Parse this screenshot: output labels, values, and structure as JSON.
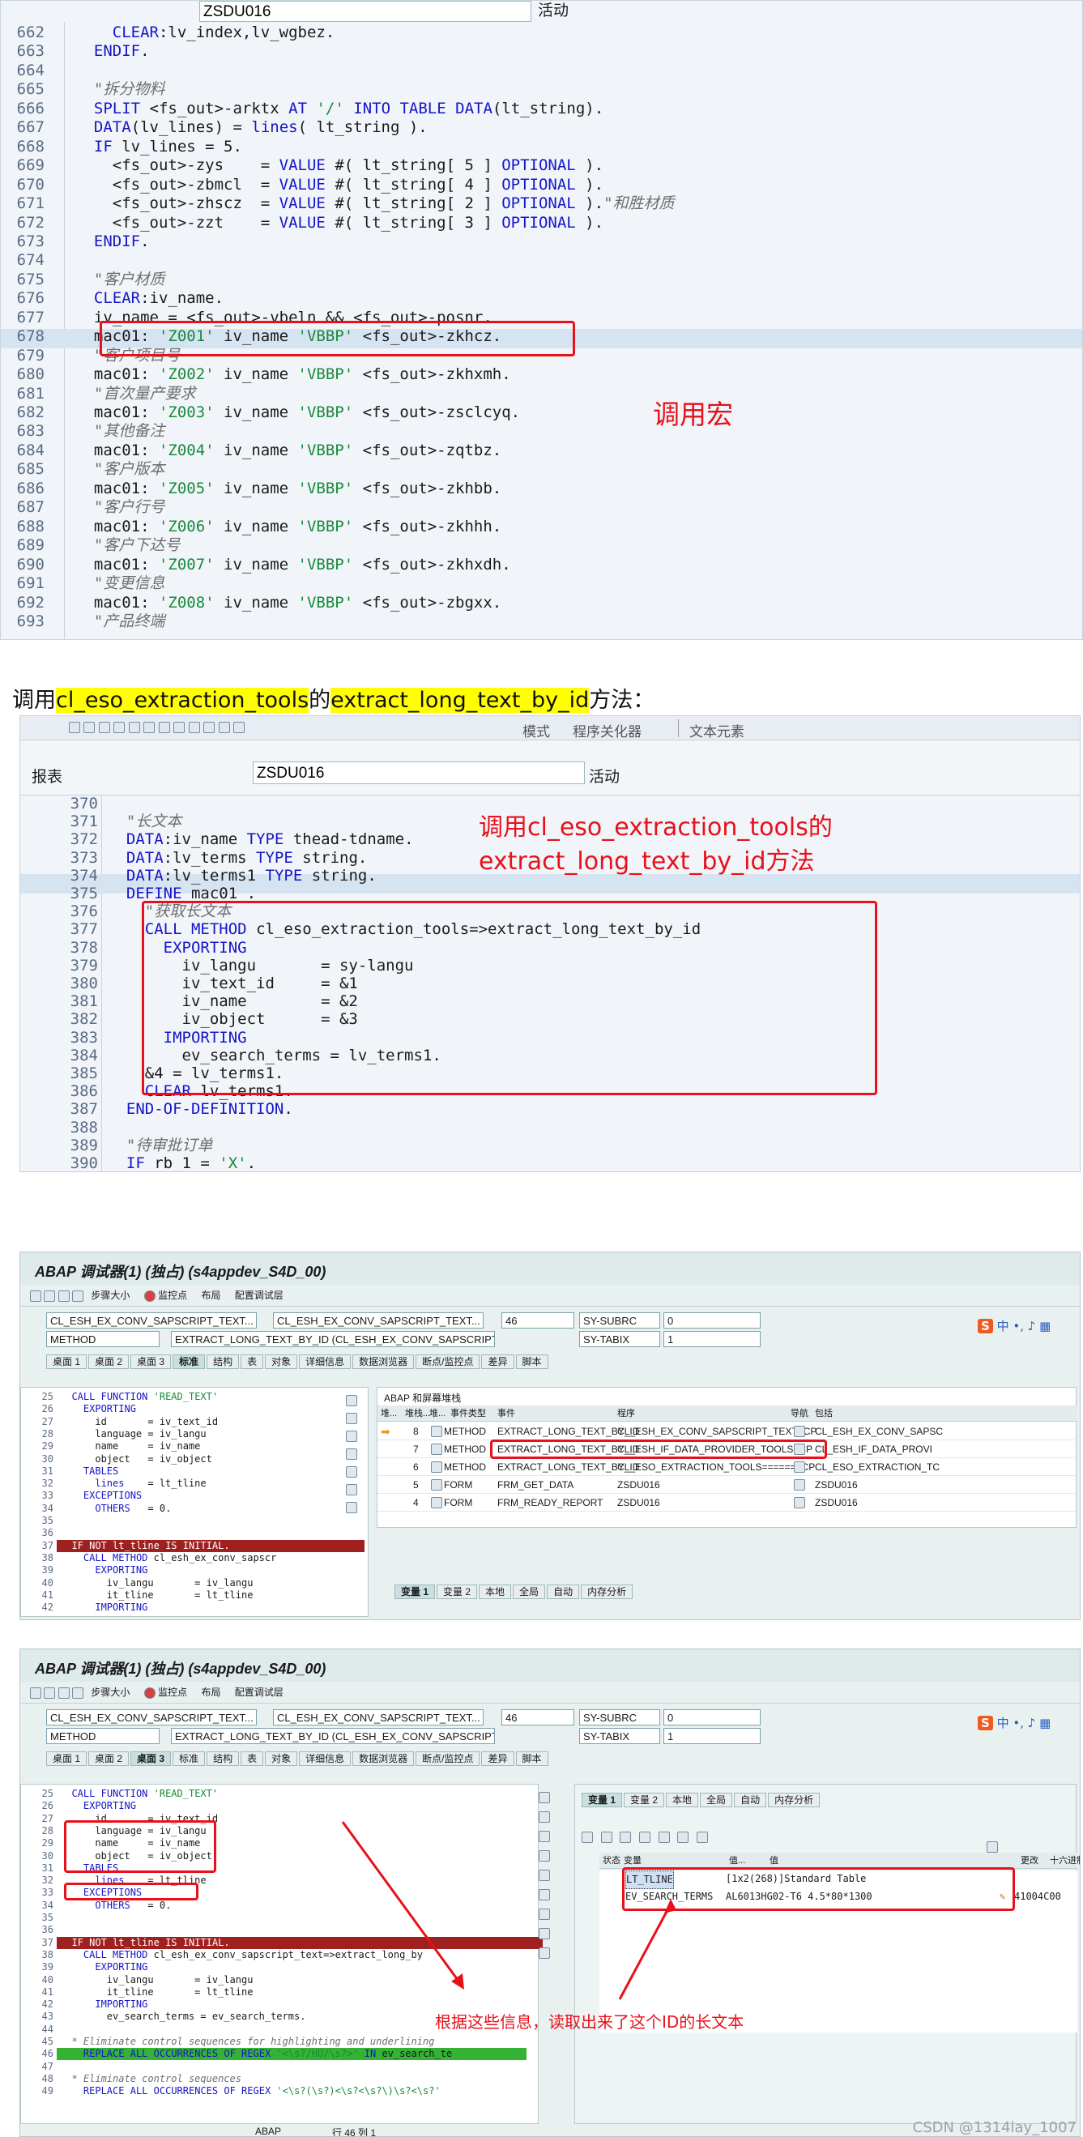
{
  "block1": {
    "report_field": "ZSDU016",
    "report_field_right": "活动",
    "lines": [
      {
        "n": "662",
        "t": "    CLEAR:lv_index,lv_wgbez."
      },
      {
        "n": "663",
        "t": "  ENDIF."
      },
      {
        "n": "664",
        "t": ""
      },
      {
        "n": "665",
        "t": "  \"拆分物料"
      },
      {
        "n": "666",
        "t": "  SPLIT <fs_out>-arktx AT '/' INTO TABLE DATA(lt_string)."
      },
      {
        "n": "667",
        "t": "  DATA(lv_lines) = lines( lt_string )."
      },
      {
        "n": "668",
        "t": "  IF lv_lines = 5."
      },
      {
        "n": "669",
        "t": "    <fs_out>-zys    = VALUE #( lt_string[ 5 ] OPTIONAL )."
      },
      {
        "n": "670",
        "t": "    <fs_out>-zbmcl  = VALUE #( lt_string[ 4 ] OPTIONAL )."
      },
      {
        "n": "671",
        "t": "    <fs_out>-zhscz  = VALUE #( lt_string[ 2 ] OPTIONAL ).\"和胜材质"
      },
      {
        "n": "672",
        "t": "    <fs_out>-zzt    = VALUE #( lt_string[ 3 ] OPTIONAL )."
      },
      {
        "n": "673",
        "t": "  ENDIF."
      },
      {
        "n": "674",
        "t": ""
      },
      {
        "n": "675",
        "t": "  \"客户材质"
      },
      {
        "n": "676",
        "t": "  CLEAR:iv_name."
      },
      {
        "n": "677",
        "t": "  iv_name = <fs_out>-vbeln && <fs_out>-posnr."
      },
      {
        "n": "678",
        "t": "  mac01: 'Z001' iv_name 'VBBP' <fs_out>-zkhcz."
      },
      {
        "n": "679",
        "t": "  \"客户项目号"
      },
      {
        "n": "680",
        "t": "  mac01: 'Z002' iv_name 'VBBP' <fs_out>-zkhxmh."
      },
      {
        "n": "681",
        "t": "  \"首次量产要求"
      },
      {
        "n": "682",
        "t": "  mac01: 'Z003' iv_name 'VBBP' <fs_out>-zsclcyq."
      },
      {
        "n": "683",
        "t": "  \"其他备注"
      },
      {
        "n": "684",
        "t": "  mac01: 'Z004' iv_name 'VBBP' <fs_out>-zqtbz."
      },
      {
        "n": "685",
        "t": "  \"客户版本"
      },
      {
        "n": "686",
        "t": "  mac01: 'Z005' iv_name 'VBBP' <fs_out>-zkhbb."
      },
      {
        "n": "687",
        "t": "  \"客户行号"
      },
      {
        "n": "688",
        "t": "  mac01: 'Z006' iv_name 'VBBP' <fs_out>-zkhhh."
      },
      {
        "n": "689",
        "t": "  \"客户下达号"
      },
      {
        "n": "690",
        "t": "  mac01: 'Z007' iv_name 'VBBP' <fs_out>-zkhxdh."
      },
      {
        "n": "691",
        "t": "  \"变更信息"
      },
      {
        "n": "692",
        "t": "  mac01: 'Z008' iv_name 'VBBP' <fs_out>-zbgxx."
      },
      {
        "n": "693",
        "t": "  \"产品终端"
      }
    ],
    "note": "调用宏"
  },
  "caption": {
    "p1": "调用",
    "hl1": "cl_eso_extraction_tools",
    "p2": "的",
    "hl2": "extract_long_text_by_id",
    "p3": "方法："
  },
  "block2": {
    "toolbar_labels": [
      "模式",
      "程序关化器",
      "文本元素"
    ],
    "report_label": "报表",
    "report_field": "ZSDU016",
    "report_status": "活动",
    "lines": [
      {
        "n": "370",
        "t": ""
      },
      {
        "n": "371",
        "t": "  \"长文本"
      },
      {
        "n": "372",
        "t": "  DATA:iv_name TYPE thead-tdname."
      },
      {
        "n": "373",
        "t": "  DATA:lv_terms TYPE string."
      },
      {
        "n": "374",
        "t": "  DATA:lv_terms1 TYPE string."
      },
      {
        "n": "375",
        "t": "  DEFINE mac01 ."
      },
      {
        "n": "376",
        "t": "    \"获取长文本"
      },
      {
        "n": "377",
        "t": "    CALL METHOD cl_eso_extraction_tools=>extract_long_text_by_id"
      },
      {
        "n": "378",
        "t": "      EXPORTING"
      },
      {
        "n": "379",
        "t": "        iv_langu       = sy-langu"
      },
      {
        "n": "380",
        "t": "        iv_text_id     = &1"
      },
      {
        "n": "381",
        "t": "        iv_name        = &2"
      },
      {
        "n": "382",
        "t": "        iv_object      = &3"
      },
      {
        "n": "383",
        "t": "      IMPORTING"
      },
      {
        "n": "384",
        "t": "        ev_search_terms = lv_terms1."
      },
      {
        "n": "385",
        "t": "    &4 = lv_terms1."
      },
      {
        "n": "386",
        "t": "    CLEAR lv_terms1."
      },
      {
        "n": "387",
        "t": "  END-OF-DEFINITION."
      },
      {
        "n": "388",
        "t": ""
      },
      {
        "n": "389",
        "t": "  \"待审批订单"
      },
      {
        "n": "390",
        "t": "  IF rb_1 = 'X'."
      }
    ],
    "note_line1": "调用cl_eso_extraction_tools的",
    "note_line2": "extract_long_text_by_id方法"
  },
  "debugger1": {
    "title": "ABAP 调试器(1)  (独占) (s4appdev_S4D_00)",
    "toolbar": [
      "步骤大小",
      "监控点",
      "布局",
      "配置调试层"
    ],
    "f_prog": "CL_ESH_EX_CONV_SAPSCRIPT_TEXT...",
    "f_prog2": "CL_ESH_EX_CONV_SAPSCRIPT_TEXT...",
    "f_line": "46",
    "f_subrc_l": "SY-SUBRC",
    "f_subrc_v": "0",
    "f_type": "METHOD",
    "f_method": "EXTRACT_LONG_TEXT_BY_ID (CL_ESH_EX_CONV_SAPSCRIPT_T...",
    "f_tabix_l": "SY-TABIX",
    "f_tabix_v": "1",
    "tabs": [
      "桌面 1",
      "桌面 2",
      "桌面 3",
      "标准",
      "结构",
      "表",
      "对象",
      "详细信息",
      "数据浏览器",
      "断点/监控点",
      "差异",
      "脚本"
    ],
    "stack_title": "ABAP 和屏幕堆栈",
    "stack_headers": [
      "堆...",
      "堆栈...",
      "堆...",
      "事件类型",
      "事件",
      "程序",
      "导航",
      "包括"
    ],
    "stack_rows": [
      {
        "n": "8",
        "type": "METHOD",
        "event": "EXTRACT_LONG_TEXT_BY_ID",
        "prog": "CL_ESH_EX_CONV_SAPSCRIPT_TEXT=CP",
        "inc": "CL_ESH_EX_CONV_SAPSC"
      },
      {
        "n": "7",
        "type": "METHOD",
        "event": "EXTRACT_LONG_TEXT_BY_ID",
        "prog": "CL_ESH_IF_DATA_PROVIDER_TOOLS=CP",
        "inc": "CL_ESH_IF_DATA_PROVI"
      },
      {
        "n": "6",
        "type": "METHOD",
        "event": "EXTRACT_LONG_TEXT_BY_ID",
        "prog": "CL_ESO_EXTRACTION_TOOLS=======CP",
        "inc": "CL_ESO_EXTRACTION_TC"
      },
      {
        "n": "5",
        "type": "FORM",
        "event": "FRM_GET_DATA",
        "prog": "ZSDU016",
        "inc": "ZSDU016"
      },
      {
        "n": "4",
        "type": "FORM",
        "event": "FRM_READY_REPORT",
        "prog": "ZSDU016",
        "inc": "ZSDU016"
      }
    ],
    "lower_tabs": [
      "变量 1",
      "变量 2",
      "本地",
      "全局",
      "自动",
      "内存分析"
    ],
    "code": [
      {
        "n": "25",
        "t": "  CALL FUNCTION 'READ_TEXT'"
      },
      {
        "n": "26",
        "t": "    EXPORTING"
      },
      {
        "n": "27",
        "t": "      id       = iv_text_id"
      },
      {
        "n": "28",
        "t": "      language = iv_langu"
      },
      {
        "n": "29",
        "t": "      name     = iv_name"
      },
      {
        "n": "30",
        "t": "      object   = iv_object"
      },
      {
        "n": "31",
        "t": "    TABLES"
      },
      {
        "n": "32",
        "t": "      lines    = lt_tline"
      },
      {
        "n": "33",
        "t": "    EXCEPTIONS"
      },
      {
        "n": "34",
        "t": "      OTHERS   = 0."
      },
      {
        "n": "35",
        "t": ""
      },
      {
        "n": "36",
        "t": ""
      },
      {
        "n": "37",
        "t": "  IF NOT lt_tline IS INITIAL."
      },
      {
        "n": "38",
        "t": "    CALL METHOD cl_esh_ex_conv_sapscr"
      },
      {
        "n": "39",
        "t": "      EXPORTING"
      },
      {
        "n": "40",
        "t": "        iv_langu       = iv_langu"
      },
      {
        "n": "41",
        "t": "        it_tline       = lt_tline"
      },
      {
        "n": "42",
        "t": "      IMPORTING"
      }
    ]
  },
  "debugger2": {
    "title": "ABAP 调试器(1)  (独占) (s4appdev_S4D_00)",
    "toolbar": [
      "步骤大小",
      "监控点",
      "布局",
      "配置调试层"
    ],
    "f_prog": "CL_ESH_EX_CONV_SAPSCRIPT_TEXT...",
    "f_prog2": "CL_ESH_EX_CONV_SAPSCRIPT_TEXT...",
    "f_line": "46",
    "f_subrc_l": "SY-SUBRC",
    "f_subrc_v": "0",
    "f_type": "METHOD",
    "f_method": "EXTRACT_LONG_TEXT_BY_ID (CL_ESH_EX_CONV_SAPSCRIPT_T...",
    "f_tabix_l": "SY-TABIX",
    "f_tabix_v": "1",
    "tabs": [
      "桌面 1",
      "桌面 2",
      "桌面 3",
      "标准",
      "结构",
      "表",
      "对象",
      "详细信息",
      "数据浏览器",
      "断点/监控点",
      "差异",
      "脚本"
    ],
    "right_tabs": [
      "变量 1",
      "变量 2",
      "本地",
      "全局",
      "自动",
      "内存分析"
    ],
    "var_headers": [
      "状态",
      "变量",
      "值...",
      "值",
      "更改",
      "十六进制值"
    ],
    "vars": [
      {
        "name": "LT_TLINE",
        "value": "[1x2(268)]Standard Table",
        "hex": ""
      },
      {
        "name": "EV_SEARCH_TERMS",
        "value": "AL6013HG02-T6 4.5*80*1300",
        "hex": "41004C00"
      }
    ],
    "code": [
      {
        "n": "25",
        "t": "  CALL FUNCTION 'READ_TEXT'"
      },
      {
        "n": "26",
        "t": "    EXPORTING"
      },
      {
        "n": "27",
        "t": "      id       = iv_text_id"
      },
      {
        "n": "28",
        "t": "      language = iv_langu"
      },
      {
        "n": "29",
        "t": "      name     = iv_name"
      },
      {
        "n": "30",
        "t": "      object   = iv_object"
      },
      {
        "n": "31",
        "t": "    TABLES"
      },
      {
        "n": "32",
        "t": "      lines    = lt_tline"
      },
      {
        "n": "33",
        "t": "    EXCEPTIONS"
      },
      {
        "n": "34",
        "t": "      OTHERS   = 0."
      },
      {
        "n": "35",
        "t": ""
      },
      {
        "n": "36",
        "t": ""
      },
      {
        "n": "37",
        "t": "  IF NOT lt_tline IS INITIAL."
      },
      {
        "n": "38",
        "t": "    CALL METHOD cl_esh_ex_conv_sapscript_text=>extract_long_by"
      },
      {
        "n": "39",
        "t": "      EXPORTING"
      },
      {
        "n": "40",
        "t": "        iv_langu       = iv_langu"
      },
      {
        "n": "41",
        "t": "        it_tline       = lt_tline"
      },
      {
        "n": "42",
        "t": "      IMPORTING"
      },
      {
        "n": "43",
        "t": "        ev_search_terms = ev_search_terms."
      },
      {
        "n": "44",
        "t": ""
      },
      {
        "n": "45",
        "t": "  * Eliminate control sequences for highlighting and underlining"
      },
      {
        "n": "46",
        "t": "    REPLACE ALL OCCURRENCES OF REGEX '<\\s?/HU/\\s?>' IN ev_search_te"
      },
      {
        "n": "47",
        "t": ""
      },
      {
        "n": "48",
        "t": "  * Eliminate control sequences"
      },
      {
        "n": "49",
        "t": "    REPLACE ALL OCCURRENCES OF REGEX '<\\s?(\\s?)<\\s?<\\s?\\)\\s?<\\s?'"
      }
    ],
    "status_left": "ABAP",
    "status_row": "行 46 列  1",
    "note": "根据这些信息，读取出来了这个ID的长文本",
    "watermark": "CSDN @1314lay_1007"
  }
}
